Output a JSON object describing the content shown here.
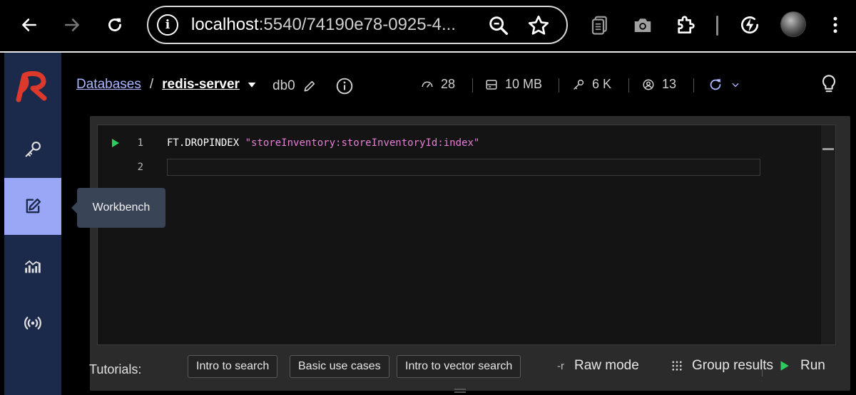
{
  "browser": {
    "url_host": "localhost",
    "url_rest": ":5540/74190e78-0925-4..."
  },
  "sidebar": {
    "items": [
      {
        "name": "browser",
        "icon": "key-icon"
      },
      {
        "name": "workbench",
        "icon": "edit-square-icon",
        "active": true
      },
      {
        "name": "analytics",
        "icon": "chart-icon"
      },
      {
        "name": "pubsub",
        "icon": "broadcast-icon"
      }
    ],
    "tooltip": "Workbench"
  },
  "header": {
    "breadcrumb_link": "Databases",
    "separator": "/",
    "db_name": "redis-server",
    "db_index": "db0",
    "stats": {
      "ops": "28",
      "memory": "10 MB",
      "keys": "6 K",
      "clients": "13"
    }
  },
  "editor": {
    "lines": [
      {
        "num": "1",
        "keyword": "FT.DROPINDEX",
        "arg": "\"storeInventory:storeInventoryId:index\""
      },
      {
        "num": "2",
        "keyword": "",
        "arg": ""
      }
    ]
  },
  "footer": {
    "tutorials_label": "Tutorials:",
    "tutorials": [
      "Intro to search",
      "Basic use cases",
      "Intro to vector search"
    ],
    "raw_mode_prefix": "-r",
    "raw_mode": "Raw mode",
    "group_results": "Group results",
    "run": "Run"
  },
  "colors": {
    "sidebar": "#1b2a4a",
    "active_item": "#9aa7f7",
    "link": "#aab6ff",
    "string": "#e37fd5",
    "run_green": "#2bcd5c",
    "logo_red": "#dc382c"
  }
}
